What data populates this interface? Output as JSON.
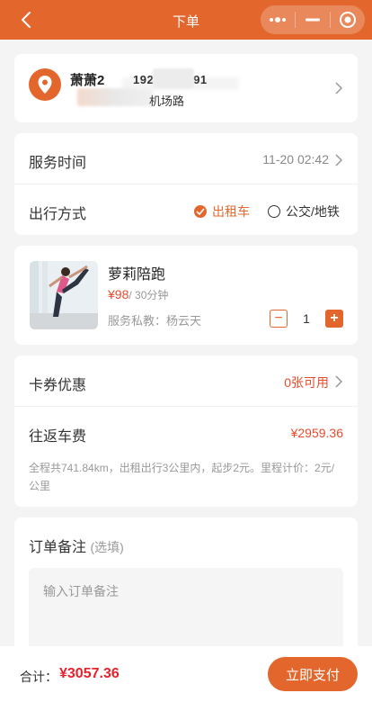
{
  "header": {
    "title": "下单"
  },
  "address": {
    "name": "萧萧2",
    "phone_prefix": "192",
    "phone_suffix": "91",
    "detail": "机场路"
  },
  "service": {
    "time_label": "服务时间",
    "time_value": "11-20 02:42",
    "travel_label": "出行方式",
    "options": [
      {
        "label": "出租车",
        "selected": true
      },
      {
        "label": "公交/地铁",
        "selected": false
      }
    ]
  },
  "product": {
    "name": "萝莉陪跑",
    "price": "¥98",
    "unit": "/ 30分钟",
    "coach": "服务私教：杨云天",
    "quantity": "1",
    "minus": "−",
    "plus": "+"
  },
  "fees": {
    "coupon_label": "卡券优惠",
    "coupon_value": "0张可用",
    "travel_fee_label": "往返车费",
    "travel_fee_value": "¥2959.36",
    "note": "全程共741.84km，出租出行3公里内，起步2元。里程计价：2元/公里"
  },
  "remark": {
    "title": "订单备注",
    "optional": "(选填)",
    "placeholder": "输入订单备注"
  },
  "footer": {
    "total_label": "合计：",
    "total_value": "¥3057.36",
    "pay_label": "立即支付"
  },
  "colors": {
    "accent": "#e3672d",
    "price": "#e84b2d",
    "total": "#e8222d"
  }
}
